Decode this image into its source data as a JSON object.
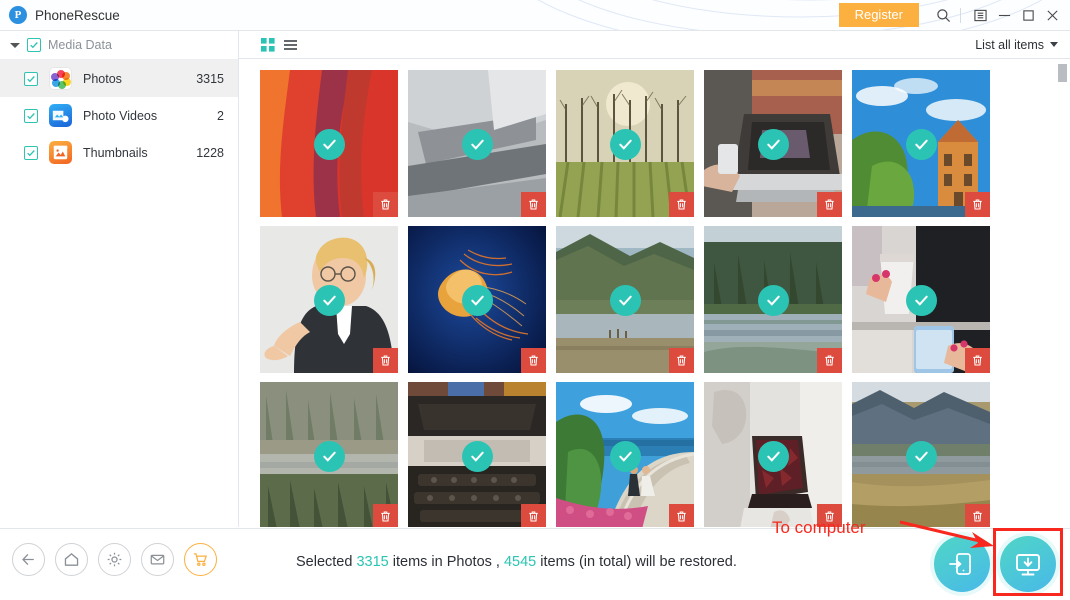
{
  "titlebar": {
    "app_name": "PhoneRescue",
    "logo_letter": "P",
    "register_label": "Register",
    "icons": [
      "search-icon",
      "panel-icon",
      "minimize-icon",
      "maximize-icon",
      "close-icon"
    ]
  },
  "sidebar": {
    "header": {
      "label": "Media Data",
      "checked": true,
      "expanded": true
    },
    "items": [
      {
        "label": "Photos",
        "count": "3315",
        "icon": "photos-icon",
        "checked": true,
        "selected": true
      },
      {
        "label": "Photo Videos",
        "count": "2",
        "icon": "photo-videos-icon",
        "checked": true,
        "selected": false
      },
      {
        "label": "Thumbnails",
        "count": "1228",
        "icon": "thumbnails-icon",
        "checked": true,
        "selected": false
      }
    ]
  },
  "toolbar": {
    "grid_view_icon": "grid-view-icon",
    "list_view_icon": "list-view-icon",
    "active_view": "grid",
    "sort_label": "List all items"
  },
  "grid": {
    "columns": 5,
    "all_selected": true,
    "tiles": [
      {
        "name": "red-canyon-waves",
        "selected": true
      },
      {
        "name": "grayscale-architecture",
        "selected": true
      },
      {
        "name": "bare-trees-field",
        "selected": true
      },
      {
        "name": "laptop-street-scene",
        "selected": true
      },
      {
        "name": "dutch-houses-blue-sky",
        "selected": true
      },
      {
        "name": "businesswoman-portrait",
        "selected": true
      },
      {
        "name": "jellyfish-blue-water",
        "selected": true
      },
      {
        "name": "mountain-lake-view",
        "selected": true
      },
      {
        "name": "forest-lake-reflection",
        "selected": true
      },
      {
        "name": "coffee-cup-phone-desk",
        "selected": true
      },
      {
        "name": "pine-forest-river",
        "selected": true
      },
      {
        "name": "vintage-typewriter",
        "selected": true
      },
      {
        "name": "coastal-wedding-path",
        "selected": true
      },
      {
        "name": "dark-object-on-white",
        "selected": true
      },
      {
        "name": "mountain-lake-meadow",
        "selected": true
      }
    ]
  },
  "bottombar": {
    "tools": [
      {
        "name": "back-button",
        "icon": "arrow-left-icon",
        "accent": false
      },
      {
        "name": "home-button",
        "icon": "home-icon",
        "accent": false
      },
      {
        "name": "settings-button",
        "icon": "gear-icon",
        "accent": false
      },
      {
        "name": "mail-button",
        "icon": "mail-icon",
        "accent": false
      },
      {
        "name": "cart-button",
        "icon": "cart-icon",
        "accent": true
      }
    ],
    "status": {
      "prefix": "Selected ",
      "selected_count": "3315",
      "middle": " items in Photos , ",
      "total_count": "4545",
      "suffix": " items (in total) will be restored."
    },
    "actions": [
      {
        "name": "restore-to-device-button",
        "icon": "phone-import-icon"
      },
      {
        "name": "restore-to-computer-button",
        "icon": "computer-download-icon",
        "highlighted": true
      }
    ]
  },
  "annotation": {
    "label": "To computer",
    "color": "#f8281e"
  },
  "colors": {
    "accent_teal": "#2bc4b4",
    "accent_orange": "#fcb040",
    "annotation_red": "#f8281e",
    "delete_red": "#dd4b3e"
  }
}
